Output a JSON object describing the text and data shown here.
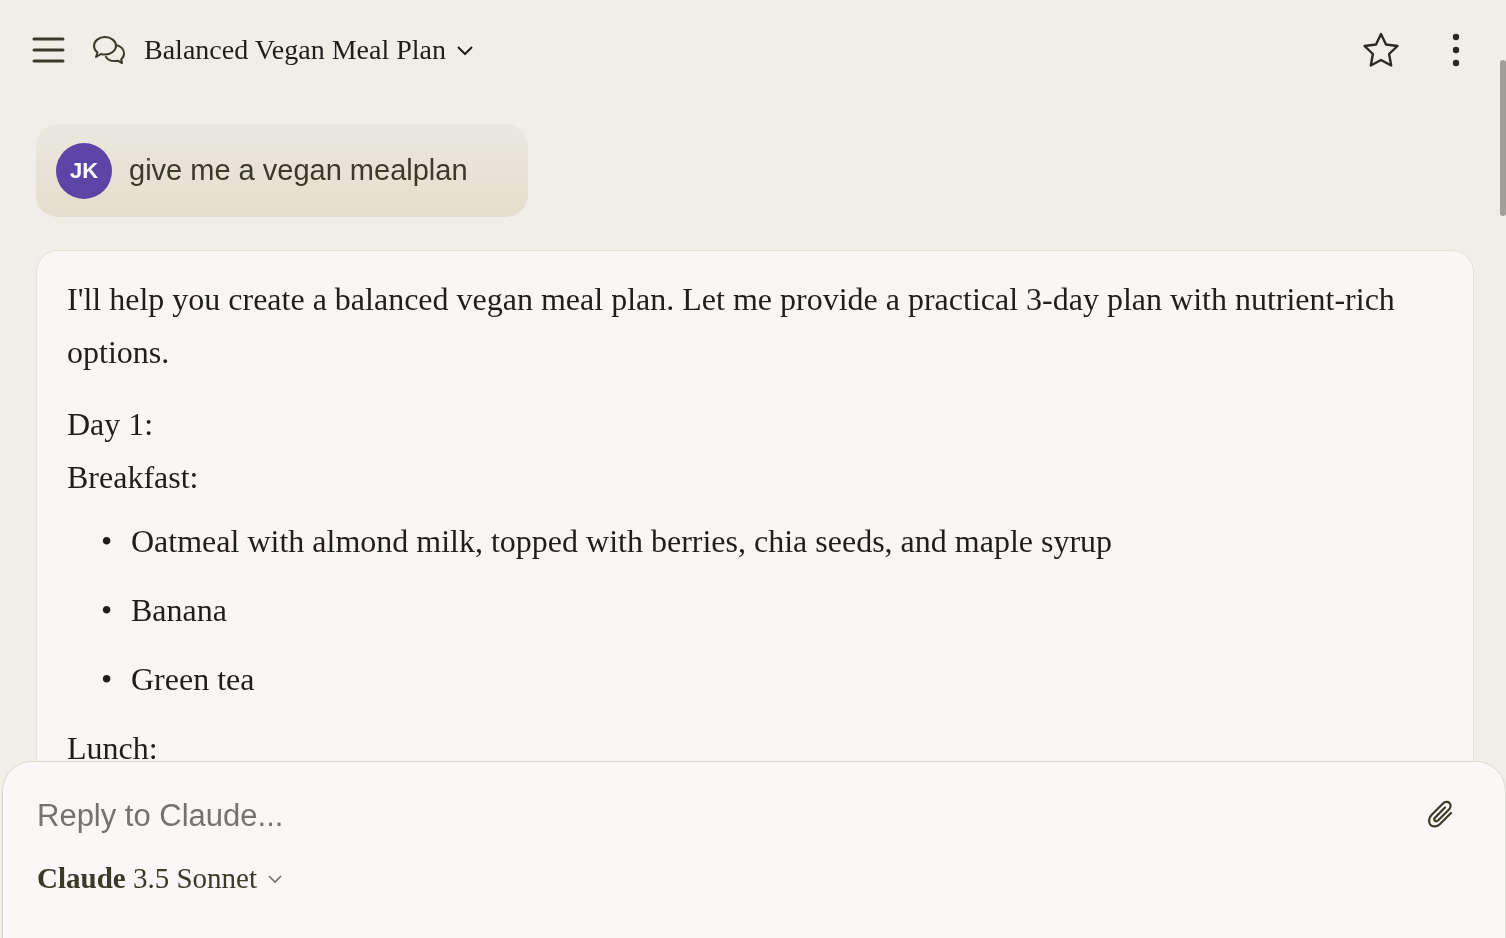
{
  "header": {
    "title": "Balanced Vegan Meal Plan"
  },
  "user_message": {
    "initials": "JK",
    "text": "give me a vegan mealplan"
  },
  "response": {
    "blocks": [
      {
        "kind": "paragraph",
        "text": "I'll help you create a balanced vegan meal plan. Let me provide a practical 3-day plan with nutrient-rich options."
      },
      {
        "kind": "line",
        "text": "Day 1:"
      },
      {
        "kind": "line",
        "text": "Breakfast:"
      },
      {
        "kind": "bullets",
        "items": [
          {
            "marker": "•",
            "text": "Oatmeal with almond milk, topped with berries, chia seeds, and maple syrup"
          },
          {
            "marker": "•",
            "text": "Banana"
          },
          {
            "marker": "•",
            "text": "Green tea"
          }
        ]
      },
      {
        "kind": "line",
        "text": "Lunch:"
      }
    ]
  },
  "composer": {
    "placeholder": "Reply to Claude...",
    "model": "**Claude** 3.5 Sonnet"
  }
}
